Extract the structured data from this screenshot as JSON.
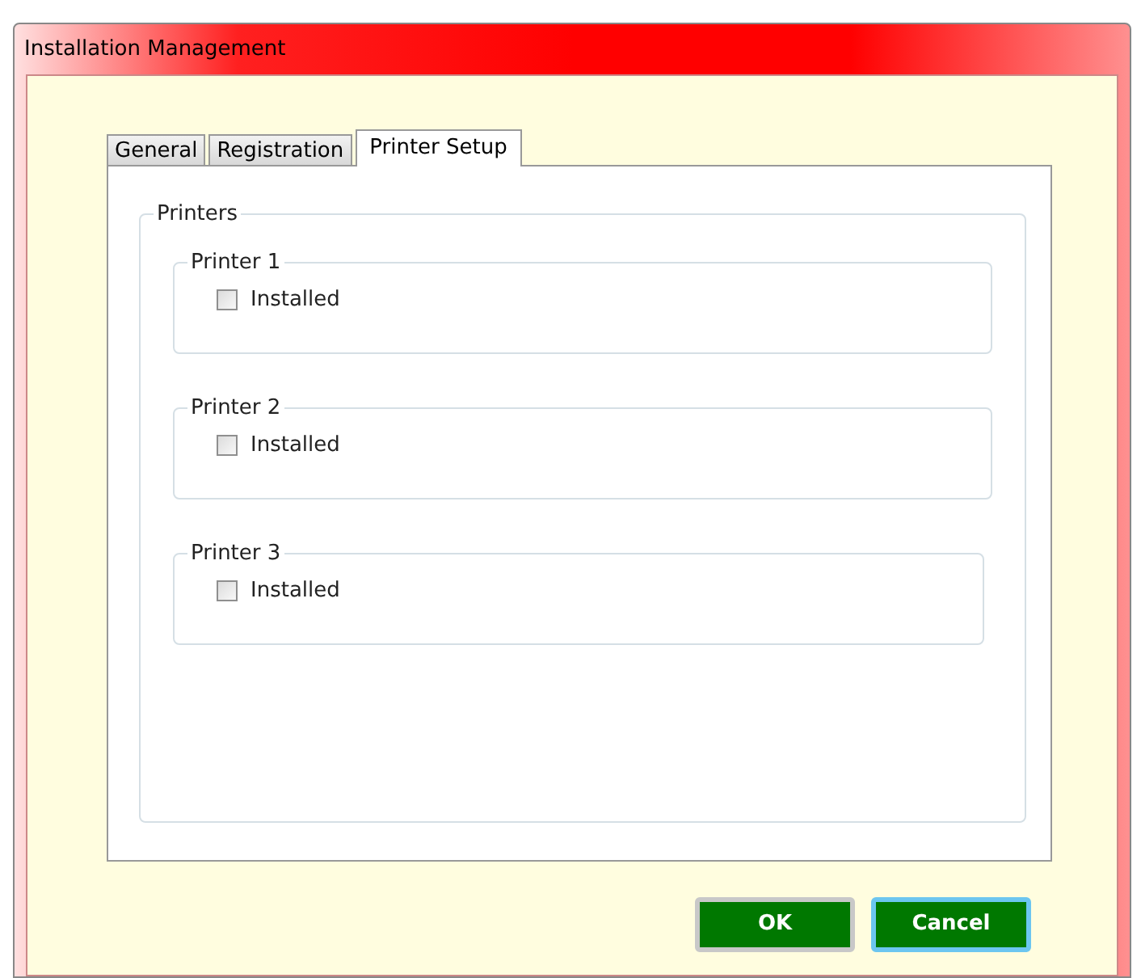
{
  "window": {
    "title": "Installation Management"
  },
  "tabs": [
    {
      "label": "General",
      "selected": false
    },
    {
      "label": "Registration",
      "selected": false
    },
    {
      "label": "Printer Setup",
      "selected": true
    }
  ],
  "group": {
    "title": "Printers"
  },
  "printers": [
    {
      "title": "Printer 1",
      "option": "Installed",
      "checked": false
    },
    {
      "title": "Printer 2",
      "option": "Installed",
      "checked": false
    },
    {
      "title": "Printer 3",
      "option": "Installed",
      "checked": false
    }
  ],
  "buttons": [
    {
      "label": "OK",
      "focused": false
    },
    {
      "label": "Cancel",
      "focused": true
    }
  ]
}
